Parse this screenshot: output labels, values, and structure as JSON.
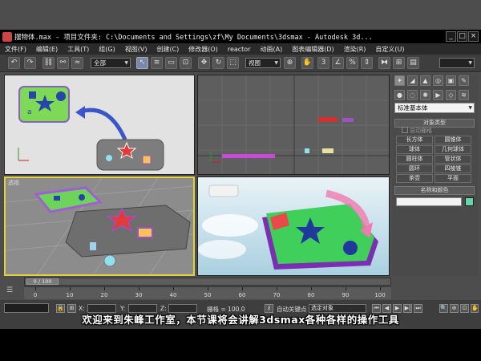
{
  "window": {
    "title": "摆物体.max  - 项目文件夹: C:\\Documents and Settings\\zf\\My Documents\\3dsmax  - Autodesk 3d..."
  },
  "menu": [
    "文件(F)",
    "编辑(E)",
    "工具(T)",
    "组(G)",
    "视图(V)",
    "创建(C)",
    "修改器(O)",
    "reactor",
    "动画(A)",
    "图表编辑器(D)",
    "渲染(R)",
    "自定义(U)"
  ],
  "toolbar": {
    "selection_filter": "全部",
    "reference_coord": "视图"
  },
  "viewports": {
    "perspective_label": "透视"
  },
  "command_panel": {
    "category": "标准基本体",
    "object_type_title": "对象类型",
    "autogrid_label": "自动栅格",
    "objects": [
      "长方体",
      "圆锥体",
      "球体",
      "几何球体",
      "圆柱体",
      "管状体",
      "圆环",
      "四棱锥",
      "茶壶",
      "平面"
    ],
    "name_color_title": "名称和颜色",
    "object_color": "#66d6a8"
  },
  "timeline": {
    "slider_text": "0 / 100",
    "ticks": [
      "0",
      "10",
      "20",
      "30",
      "40",
      "50",
      "60",
      "70",
      "80",
      "90",
      "100"
    ]
  },
  "status": {
    "x_label": "X:",
    "y_label": "Y:",
    "z_label": "Z:",
    "grid_text": "栅格 = 100.0",
    "autokey_label": "自动关键点",
    "key_filter_value": "选定对象"
  },
  "subtitle": "欢迎来到朱峰工作室，本节课将会讲解3dsmax各种各样的操作工具"
}
